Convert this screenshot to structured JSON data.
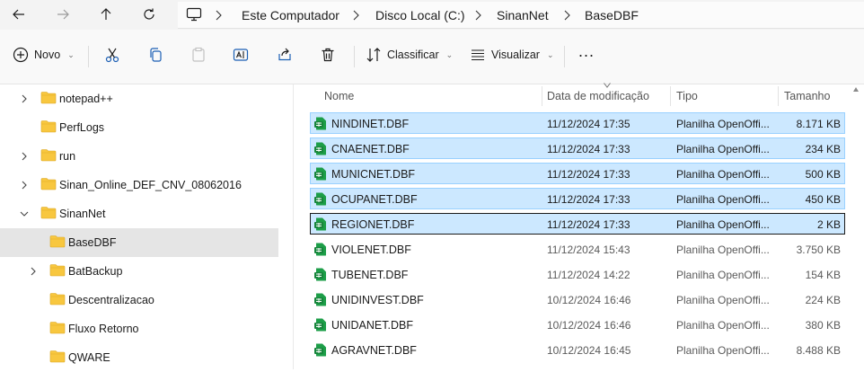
{
  "breadcrumb": [
    "Este Computador",
    "Disco Local (C:)",
    "SinanNet",
    "BaseDBF"
  ],
  "commands": {
    "new_label": "Novo",
    "sort_label": "Classificar",
    "view_label": "Visualizar",
    "more_label": "..."
  },
  "tree": [
    {
      "label": "notepad++",
      "expandable": true
    },
    {
      "label": "PerfLogs",
      "expandable": false
    },
    {
      "label": "run",
      "expandable": true
    },
    {
      "label": "Sinan_Online_DEF_CNV_08062016",
      "expandable": true
    },
    {
      "label": "SinanNet",
      "expandable": true,
      "expanded": true
    },
    {
      "label": "BaseDBF",
      "expandable": false,
      "selected": true
    },
    {
      "label": "BatBackup",
      "expandable": true
    },
    {
      "label": "Descentralizacao",
      "expandable": false
    },
    {
      "label": "Fluxo Retorno",
      "expandable": false
    },
    {
      "label": "QWARE",
      "expandable": false
    }
  ],
  "columns": {
    "name": "Nome",
    "date": "Data de modificação",
    "type": "Tipo",
    "size": "Tamanho"
  },
  "files": [
    {
      "name": "NINDINET.DBF",
      "date": "11/12/2024 17:35",
      "type": "Planilha OpenOffi...",
      "size": "8.171 KB",
      "state": "selected"
    },
    {
      "name": "CNAENET.DBF",
      "date": "11/12/2024 17:33",
      "type": "Planilha OpenOffi...",
      "size": "234 KB",
      "state": "selected"
    },
    {
      "name": "MUNICNET.DBF",
      "date": "11/12/2024 17:33",
      "type": "Planilha OpenOffi...",
      "size": "500 KB",
      "state": "selected"
    },
    {
      "name": "OCUPANET.DBF",
      "date": "11/12/2024 17:33",
      "type": "Planilha OpenOffi...",
      "size": "450 KB",
      "state": "selected"
    },
    {
      "name": "REGIONET.DBF",
      "date": "11/12/2024 17:33",
      "type": "Planilha OpenOffi...",
      "size": "2 KB",
      "state": "focus"
    },
    {
      "name": "VIOLENET.DBF",
      "date": "11/12/2024 15:43",
      "type": "Planilha OpenOffi...",
      "size": "3.750 KB",
      "state": "normal"
    },
    {
      "name": "TUBENET.DBF",
      "date": "11/12/2024 14:22",
      "type": "Planilha OpenOffi...",
      "size": "154 KB",
      "state": "normal"
    },
    {
      "name": "UNIDINVEST.DBF",
      "date": "10/12/2024 16:46",
      "type": "Planilha OpenOffi...",
      "size": "224 KB",
      "state": "normal"
    },
    {
      "name": "UNIDANET.DBF",
      "date": "10/12/2024 16:46",
      "type": "Planilha OpenOffi...",
      "size": "380 KB",
      "state": "normal"
    },
    {
      "name": "AGRAVNET.DBF",
      "date": "10/12/2024 16:45",
      "type": "Planilha OpenOffi...",
      "size": "8.488 KB",
      "state": "normal"
    }
  ],
  "colors": {
    "selection": "#cce8ff",
    "selection_border": "#99d1ff",
    "folder": "#f8c73f",
    "spreadsheet_icon": "#1d9e48"
  }
}
